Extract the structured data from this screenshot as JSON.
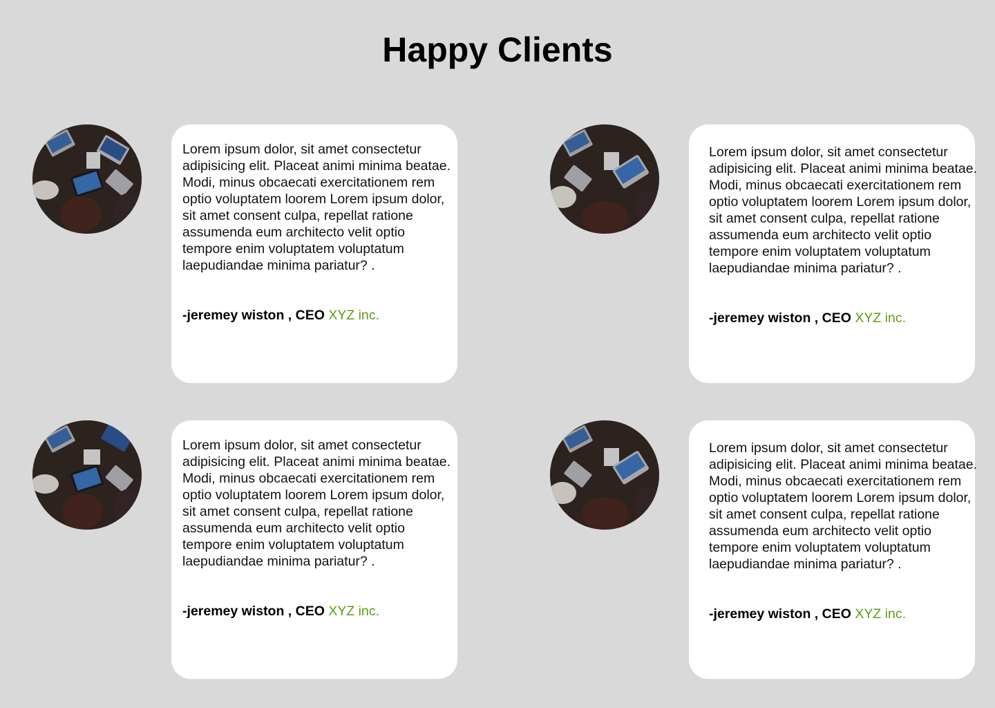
{
  "page": {
    "title": "Happy Clients"
  },
  "testimonials": [
    {
      "text": "Lorem ipsum dolor, sit amet consectetur adipisicing elit. Placeat animi minima beatae. Modi, minus obcaecati exercitationem rem optio voluptatem loorem Lorem ipsum dolor, sit amet consent culpa, repellat ratione assumenda eum architecto velit optio tempore enim voluptatem voluptatum laepudiandae minima pariatur? .",
      "author": "-jeremey wiston , CEO",
      "company": "XYZ inc."
    },
    {
      "text": "Lorem ipsum dolor, sit amet consectetur adipisicing elit. Placeat animi minima beatae. Modi, minus obcaecati exercitationem rem optio voluptatem loorem Lorem ipsum dolor, sit amet consent culpa, repellat ratione assumenda eum architecto velit optio tempore enim voluptatem voluptatum laepudiandae minima pariatur? .",
      "author": "-jeremey wiston , CEO",
      "company": "XYZ inc."
    },
    {
      "text": "Lorem ipsum dolor, sit amet consectetur adipisicing elit. Placeat animi minima beatae. Modi, minus obcaecati exercitationem rem optio voluptatem loorem Lorem ipsum dolor, sit amet consent culpa, repellat ratione assumenda eum architecto velit optio tempore enim voluptatem voluptatum laepudiandae minima pariatur? .",
      "author": "-jeremey wiston , CEO",
      "company": "XYZ inc."
    },
    {
      "text": "Lorem ipsum dolor, sit amet consectetur adipisicing elit. Placeat animi minima beatae. Modi, minus obcaecati exercitationem rem optio voluptatem loorem Lorem ipsum dolor, sit amet consent culpa, repellat ratione assumenda eum architecto velit optio tempore enim voluptatem voluptatum laepudiandae minima pariatur? .",
      "author": "-jeremey wiston , CEO",
      "company": "XYZ inc."
    }
  ],
  "colors": {
    "background": "#d9d9d9",
    "card": "#ffffff",
    "company_accent": "#5f9a14"
  },
  "icons": {
    "avatar": "client-photo-meeting-table"
  }
}
